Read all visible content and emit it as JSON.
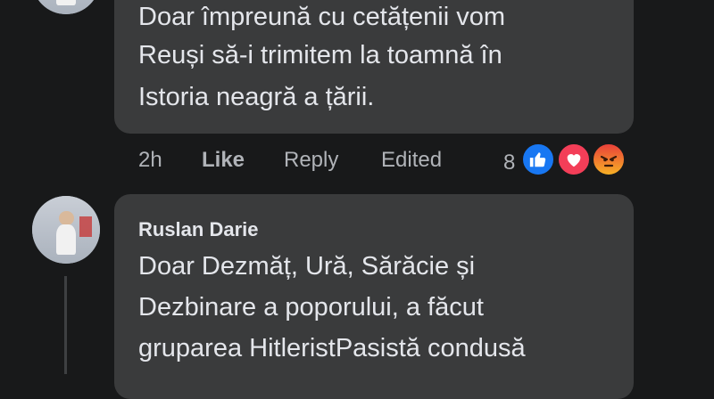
{
  "comment1": {
    "lines": [
      "Doar împreună cu cetățenii vom",
      "Reuși să-i trimitem la toamnă în",
      "Istoria neagră a țării."
    ],
    "time": "2h",
    "like_label": "Like",
    "reply_label": "Reply",
    "edited_label": "Edited",
    "reaction_count": "8",
    "reactions": [
      "like-icon",
      "love-icon",
      "angry-icon"
    ],
    "colors": {
      "like": "#1877f2",
      "love": "#f33e58",
      "angry": "#e9710f"
    }
  },
  "comment2": {
    "author": "Ruslan Darie",
    "lines": [
      "Doar Dezmăț, Ură, Sărăcie și",
      "Dezbinare a poporului, a făcut",
      "gruparea HitleristPasistă condusă"
    ]
  }
}
